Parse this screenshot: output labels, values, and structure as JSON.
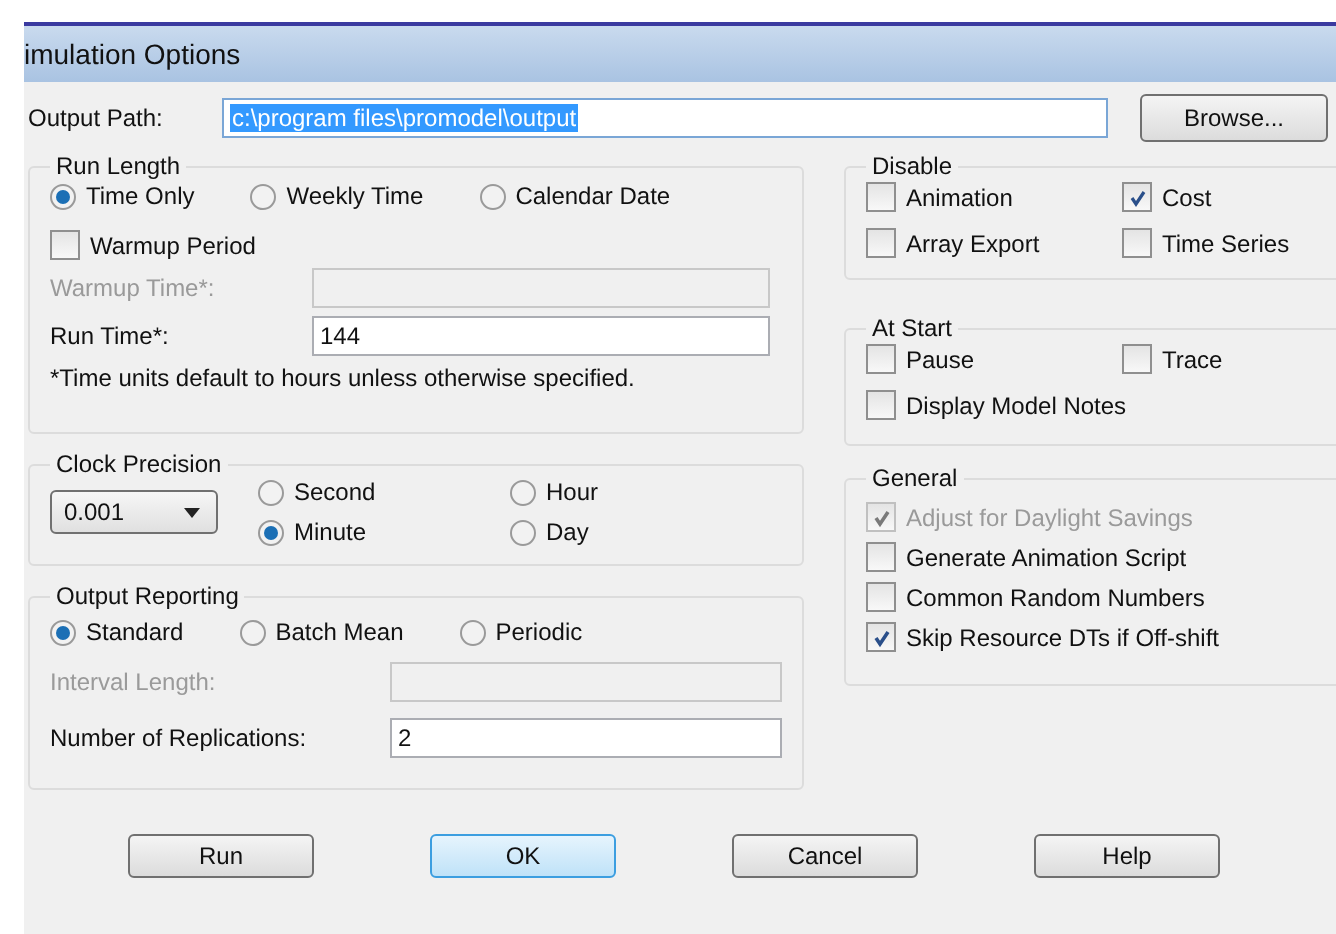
{
  "window": {
    "title": "imulation Options"
  },
  "output_path": {
    "label": "Output Path:",
    "value": "c:\\program files\\promodel\\output",
    "selected": true
  },
  "browse_button": "Browse...",
  "run_length": {
    "title": "Run Length",
    "modes": [
      {
        "label": "Time Only",
        "selected": true
      },
      {
        "label": "Weekly Time",
        "selected": false
      },
      {
        "label": "Calendar Date",
        "selected": false
      }
    ],
    "warmup": {
      "label": "Warmup Period",
      "checked": false
    },
    "fields": [
      {
        "label": "Warmup Time*:",
        "disabled": true
      },
      {
        "label": "Run Time*:",
        "value": "144",
        "disabled": false
      }
    ],
    "note": "*Time units default to hours unless otherwise specified."
  },
  "clock_precision": {
    "title": "Clock Precision",
    "value": "0.001",
    "units": [
      {
        "label": "Second",
        "selected": false
      },
      {
        "label": "Hour",
        "selected": false
      },
      {
        "label": "Minute",
        "selected": true
      },
      {
        "label": "Day",
        "selected": false
      }
    ]
  },
  "output_reporting": {
    "title": "Output Reporting",
    "modes": [
      {
        "label": "Standard",
        "selected": true
      },
      {
        "label": "Batch Mean",
        "selected": false
      },
      {
        "label": "Periodic",
        "selected": false
      }
    ],
    "fields": [
      {
        "label": "Interval Length:",
        "disabled": true
      },
      {
        "label": "Number of Replications:",
        "value": "2",
        "disabled": false
      }
    ]
  },
  "disable": {
    "title": "Disable",
    "options": [
      {
        "label": "Animation",
        "checked": false
      },
      {
        "label": "Cost",
        "checked": true
      },
      {
        "label": "Array Export",
        "checked": false
      },
      {
        "label": "Time Series",
        "checked": false
      }
    ]
  },
  "at_start": {
    "title": "At Start",
    "options": [
      {
        "label": "Pause",
        "checked": false
      },
      {
        "label": "Trace",
        "checked": false
      },
      {
        "label": "Display Model Notes",
        "checked": false
      }
    ]
  },
  "general": {
    "title": "General",
    "options": [
      {
        "label": "Adjust for Daylight Savings",
        "checked": true,
        "disabled": true
      },
      {
        "label": "Generate Animation Script",
        "checked": false,
        "disabled": false
      },
      {
        "label": "Common Random Numbers",
        "checked": false,
        "disabled": false
      },
      {
        "label": "Skip Resource DTs if Off-shift",
        "checked": true,
        "disabled": false
      }
    ]
  },
  "buttons": [
    {
      "label": "Run",
      "default": false
    },
    {
      "label": "OK",
      "default": true
    },
    {
      "label": "Cancel",
      "default": false
    },
    {
      "label": "Help",
      "default": false
    }
  ]
}
